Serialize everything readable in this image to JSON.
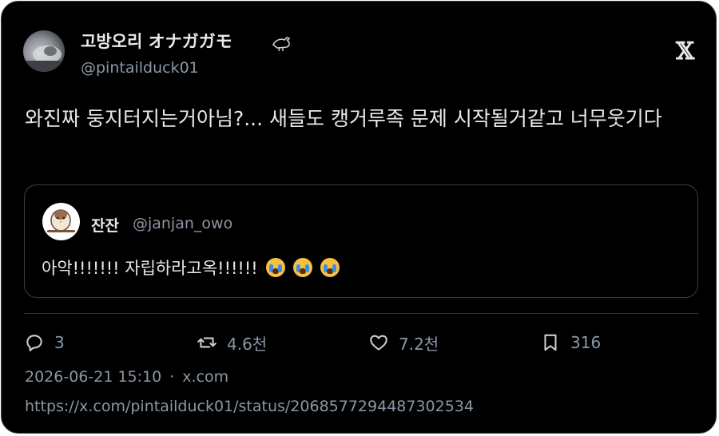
{
  "author": {
    "display_name": "고방오리 オナガガモ",
    "handle": "@pintailduck01",
    "badge_icon": "bird-icon"
  },
  "platform": {
    "logo": "𝕏",
    "icon": "x-logo-icon"
  },
  "tweet": {
    "text": "와진짜 둥지터지는거아님?... 새들도 캥거루족 문제 시작될거같고 너무웃기다"
  },
  "quoted_tweet": {
    "display_name": "잔잔",
    "handle": "@janjan_owo",
    "text": "아악!!!!!!! 자립하라고옥!!!!!!",
    "emojis": [
      "crying-face-icon",
      "crying-face-icon",
      "crying-face-icon"
    ]
  },
  "actions": {
    "replies": "3",
    "retweets": "4.6천",
    "likes": "7.2천",
    "bookmarks": "316"
  },
  "meta": {
    "timestamp": "2026-06-21 15:10",
    "separator": "·",
    "source": "x.com",
    "url": "https://x.com/pintailduck01/status/2068577294487302534"
  },
  "colors": {
    "background": "#000000",
    "text": "#e7e9ea",
    "secondary_text": "#8b98a5",
    "border": "#3a3d41"
  }
}
